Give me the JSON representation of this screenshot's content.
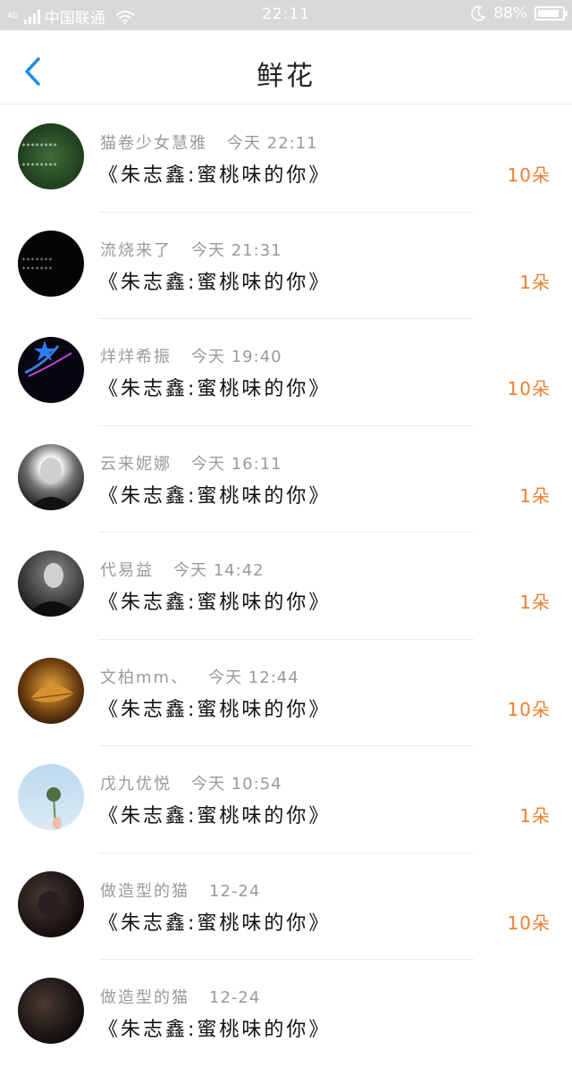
{
  "status_bar": {
    "network": "4G",
    "carrier": "中国联通",
    "time": "22:11",
    "battery": "88%",
    "battery_level": 0.88
  },
  "nav": {
    "back_icon": "chevron-left-icon",
    "title": "鲜花"
  },
  "colors": {
    "accent": "#1e90e6",
    "count": "#f07f2c"
  },
  "items": [
    {
      "name": "猫卷少女慧雅",
      "time": "今天 22:11",
      "song": "《朱志鑫:蜜桃味的你》",
      "count": "10朵"
    },
    {
      "name": "流烧来了",
      "time": "今天 21:31",
      "song": "《朱志鑫:蜜桃味的你》",
      "count": "1朵"
    },
    {
      "name": "烊烊希振",
      "time": "今天 19:40",
      "song": "《朱志鑫:蜜桃味的你》",
      "count": "10朵"
    },
    {
      "name": "云来妮娜",
      "time": "今天 16:11",
      "song": "《朱志鑫:蜜桃味的你》",
      "count": "1朵"
    },
    {
      "name": "代易益",
      "time": "今天 14:42",
      "song": "《朱志鑫:蜜桃味的你》",
      "count": "1朵"
    },
    {
      "name": "文柏mm、",
      "time": "今天 12:44",
      "song": "《朱志鑫:蜜桃味的你》",
      "count": "10朵"
    },
    {
      "name": "戊九优悦",
      "time": "今天 10:54",
      "song": "《朱志鑫:蜜桃味的你》",
      "count": "1朵"
    },
    {
      "name": "做造型的猫",
      "time": "12-24",
      "song": "《朱志鑫:蜜桃味的你》",
      "count": "10朵"
    },
    {
      "name": "做造型的猫",
      "time": "12-24",
      "song": "《朱志鑫:蜜桃味的你》",
      "count": ""
    }
  ]
}
